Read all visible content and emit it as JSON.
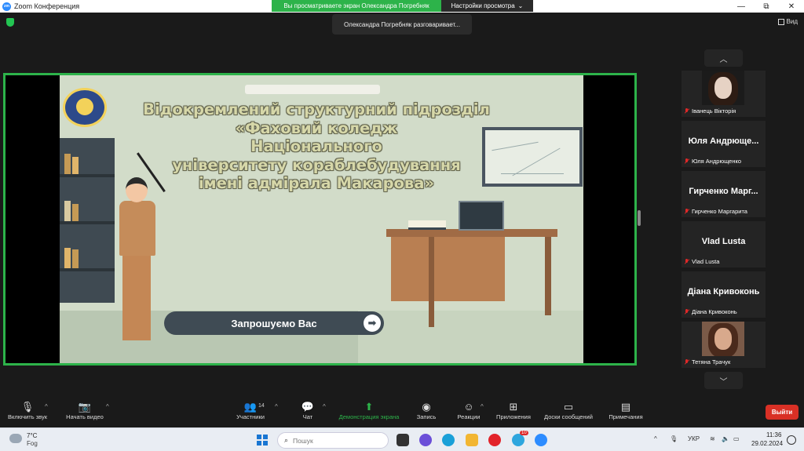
{
  "window": {
    "title": "Zoom Конференция",
    "share_banner": "Вы просматриваете экран Олександра Погребняк",
    "view_options": "Настройки просмотра",
    "view_options_caret": "⌄",
    "minimize": "—",
    "maximize": "⧉",
    "close": "✕"
  },
  "meeting": {
    "speaker_toast": "Олександра Погребняк разговаривает...",
    "view_label": "Вид"
  },
  "slide": {
    "title_lines": [
      "Відокремлений структурний підрозділ",
      "«Фаховий коледж",
      "Національного",
      "університету кораблебудування",
      "імені адмірала Макарова»"
    ],
    "invite_text": "Запрошуємо Вас",
    "invite_arrow": "➡"
  },
  "gallery": {
    "up": "︿",
    "down": "﹀",
    "participants": [
      {
        "display": "",
        "name": "Іванець Вікторія",
        "has_video": true
      },
      {
        "display": "Юля Андрюще...",
        "name": "Юля Андрющенко",
        "has_video": false
      },
      {
        "display": "Гирченко Марг...",
        "name": "Гирченко Маргарита",
        "has_video": false
      },
      {
        "display": "Vlad Lusta",
        "name": "Vlad Lusta",
        "has_video": false
      },
      {
        "display": "Діана Кривоконь",
        "name": "Діана Кривоконь",
        "has_video": false
      },
      {
        "display": "",
        "name": "Тетяна Трачук",
        "has_video": true
      }
    ]
  },
  "toolbar": {
    "unmute": "Включить звук",
    "start_video": "Начать видео",
    "participants": "Участники",
    "participants_count": "14",
    "chat": "Чат",
    "share_screen": "Демонстрация экрана",
    "record": "Запись",
    "reactions": "Реакции",
    "apps": "Приложения",
    "whiteboards": "Доски сообщений",
    "notes": "Примечания",
    "leave": "Выйти",
    "caret": "^"
  },
  "taskbar": {
    "temperature": "7°C",
    "condition": "Fog",
    "search_placeholder": "Пошук",
    "language": "УКР",
    "time": "11:36",
    "date": "29.02.2024",
    "tray_up": "^",
    "badge": "10"
  },
  "colors": {
    "zoom_green": "#2db34a",
    "leave_red": "#d93025",
    "zoom_blue": "#2d8cff"
  }
}
